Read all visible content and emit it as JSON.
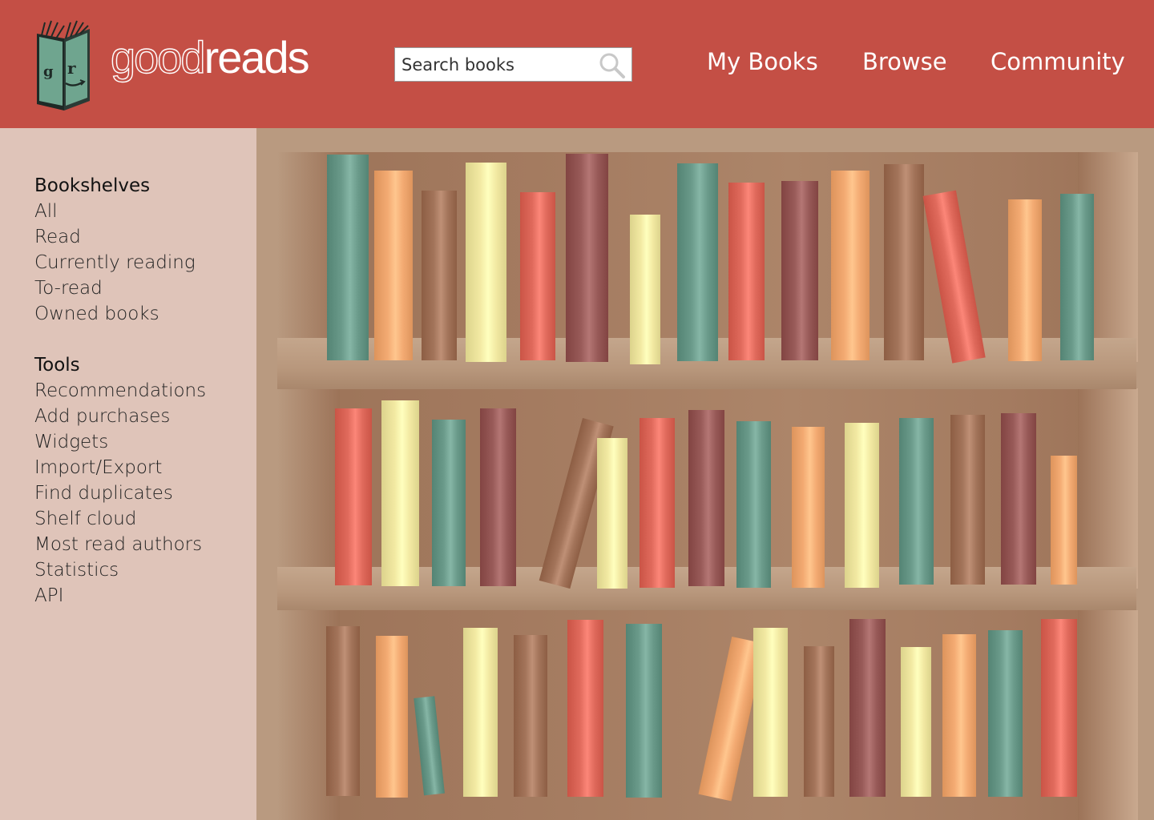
{
  "header": {
    "logo": {
      "text_light": "good",
      "text_bold": "reads"
    },
    "search": {
      "placeholder": "Search books"
    },
    "nav": [
      "My Books",
      "Browse",
      "Community"
    ]
  },
  "sidebar": {
    "sections": [
      {
        "heading": "Bookshelves",
        "items": [
          "All",
          "Read",
          "Currently reading",
          "To-read",
          "Owned books"
        ]
      },
      {
        "heading": "Tools",
        "items": [
          "Recommendations",
          "Add purchases",
          "Widgets",
          "Import/Export",
          "Find duplicates",
          "Shelf cloud",
          "Most read authors",
          "Statistics",
          "API"
        ]
      }
    ]
  },
  "colors": {
    "header": "#c44f45",
    "sidebar": "#dfc4b9",
    "book_teal": "#6a9a8a",
    "book_orange": "#f3aa72",
    "book_brown": "#a3745a",
    "book_yellow": "#f2e9a2",
    "book_red": "#e06a5c",
    "book_maroon": "#985a58"
  },
  "bookshelf": {
    "shelves": [
      {
        "book_colors": [
          "book_teal",
          "book_orange",
          "book_brown",
          "book_yellow",
          "book_red",
          "book_maroon",
          "book_yellow",
          "book_teal",
          "book_red",
          "book_maroon",
          "book_orange",
          "book_brown",
          "book_red",
          "book_orange",
          "book_teal"
        ]
      },
      {
        "book_colors": [
          "book_red",
          "book_yellow",
          "book_teal",
          "book_maroon",
          "book_brown",
          "book_yellow",
          "book_red",
          "book_maroon",
          "book_teal",
          "book_orange",
          "book_yellow",
          "book_teal",
          "book_brown",
          "book_maroon",
          "book_orange"
        ]
      },
      {
        "book_colors": [
          "book_brown",
          "book_orange",
          "book_teal",
          "book_yellow",
          "book_brown",
          "book_red",
          "book_teal",
          "book_orange",
          "book_yellow",
          "book_brown",
          "book_maroon",
          "book_yellow",
          "book_orange",
          "book_teal",
          "book_red"
        ]
      }
    ]
  }
}
